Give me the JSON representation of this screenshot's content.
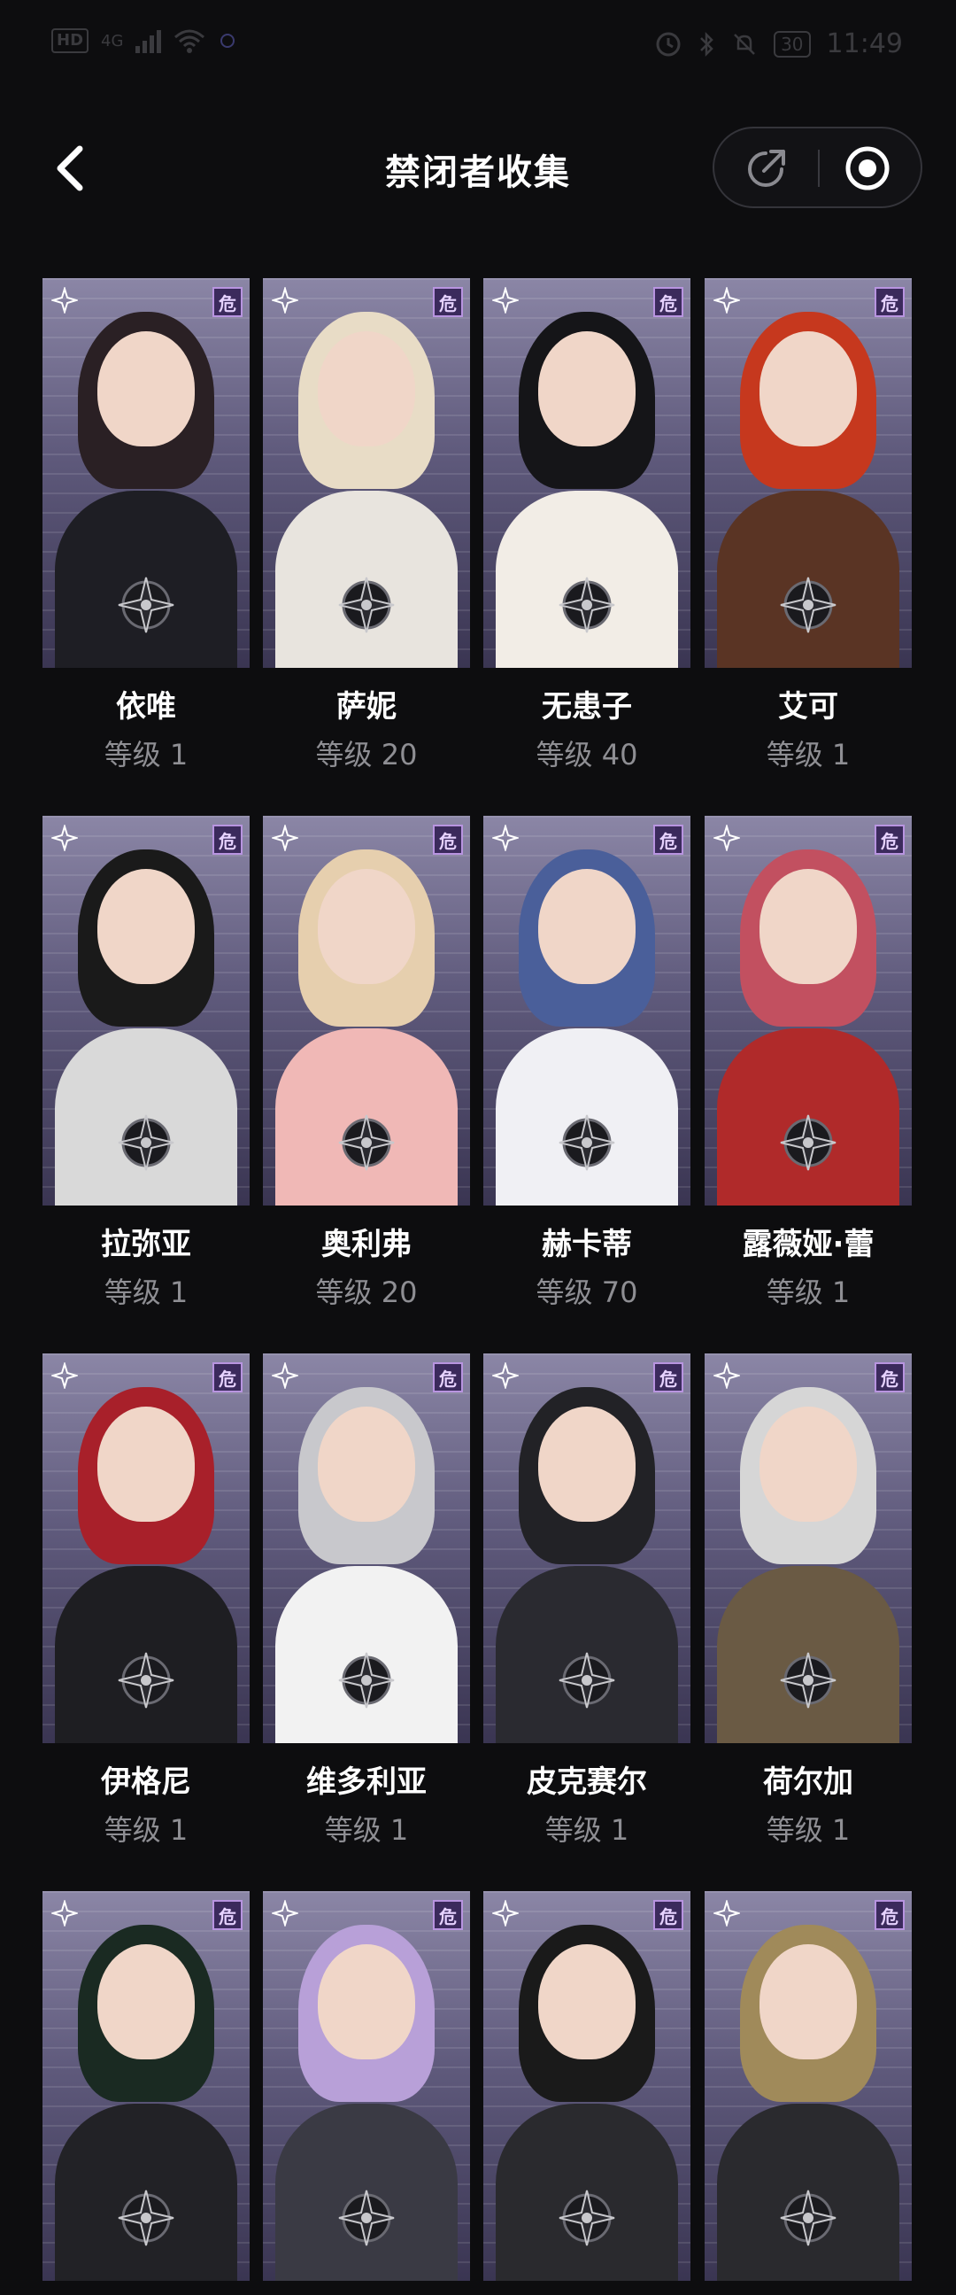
{
  "header": {
    "title": "禁闭者收集"
  },
  "status_bar": {
    "network": "HD",
    "signal": "4G",
    "battery": "30",
    "time": "11:49"
  },
  "card_badge": "危",
  "level_label": "等级",
  "characters": [
    {
      "name": "依唯",
      "level": "等级 1",
      "hair": "#2a2024",
      "outfit": "#1e1e24",
      "accent": "#d89a1a"
    },
    {
      "name": "萨妮",
      "level": "等级 20",
      "hair": "#e8dcc6",
      "outfit": "#e8e4de",
      "accent": "#5a5a5a"
    },
    {
      "name": "无患子",
      "level": "等级 40",
      "hair": "#151518",
      "outfit": "#f2ede6",
      "accent": "#1c1c1c"
    },
    {
      "name": "艾可",
      "level": "等级 1",
      "hair": "#c6381e",
      "outfit": "#5a3424",
      "accent": "#1a1a1a"
    },
    {
      "name": "拉弥亚",
      "level": "等级 1",
      "hair": "#1a1a1a",
      "outfit": "#d9d9d9",
      "accent": "#e6e6e6"
    },
    {
      "name": "奥利弗",
      "level": "等级 20",
      "hair": "#e6cfae",
      "outfit": "#f0b8b6",
      "accent": "#3a2a2a"
    },
    {
      "name": "赫卡蒂",
      "level": "等级 70",
      "hair": "#4a5f9a",
      "outfit": "#f0f0f4",
      "accent": "#2a2a32"
    },
    {
      "name": "露薇娅·蕾",
      "level": "等级 1",
      "hair": "#c25060",
      "outfit": "#b02a2a",
      "accent": "#f2e8e8"
    },
    {
      "name": "伊格尼",
      "level": "等级 1",
      "hair": "#a8202a",
      "outfit": "#1e1e22",
      "accent": "#2a2a30"
    },
    {
      "name": "维多利亚",
      "level": "等级 1",
      "hair": "#c8c8cc",
      "outfit": "#f2f2f2",
      "accent": "#c0302a"
    },
    {
      "name": "皮克赛尔",
      "level": "等级 1",
      "hair": "#222226",
      "outfit": "#2a2a30",
      "accent": "#3ac0c8"
    },
    {
      "name": "荷尔加",
      "level": "等级 1",
      "hair": "#d6d6d6",
      "outfit": "#6a5a44",
      "accent": "#3a3024"
    },
    {
      "name": "",
      "level": "",
      "hair": "#1a2a22",
      "outfit": "#222226",
      "accent": "#2a2a2e"
    },
    {
      "name": "",
      "level": "",
      "hair": "#b8a0d8",
      "outfit": "#3a3a44",
      "accent": "#2a3a5a"
    },
    {
      "name": "",
      "level": "",
      "hair": "#1a1a1a",
      "outfit": "#2a2a2e",
      "accent": "#c0302a"
    },
    {
      "name": "",
      "level": "",
      "hair": "#a08a5a",
      "outfit": "#2a2a2e",
      "accent": "#1a1a1a"
    }
  ]
}
